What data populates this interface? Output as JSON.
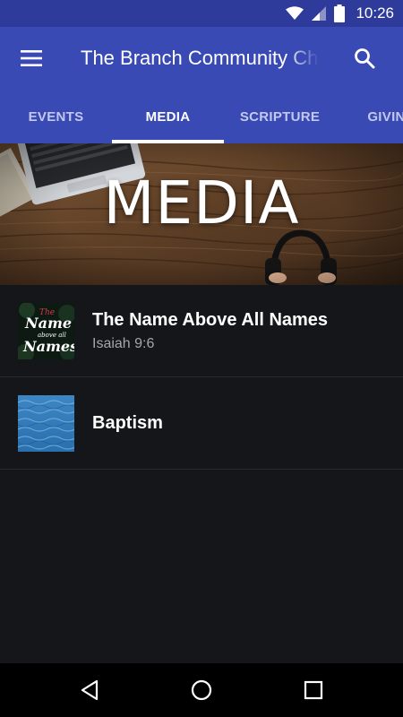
{
  "status_bar": {
    "time": "10:26",
    "icons": [
      "wifi-icon",
      "signal-icon",
      "battery-icon"
    ]
  },
  "app_bar": {
    "title": "The Branch Community Church",
    "menu_icon": "hamburger-menu-icon",
    "search_icon": "search-icon"
  },
  "tabs": [
    {
      "label": "EVENTS",
      "active": false
    },
    {
      "label": "MEDIA",
      "active": true
    },
    {
      "label": "SCRIPTURE",
      "active": false
    },
    {
      "label": "GIVING",
      "active": false
    }
  ],
  "banner": {
    "title": "MEDIA"
  },
  "media_items": [
    {
      "title": "The Name Above All Names",
      "subtitle": "Isaiah 9:6",
      "thumb_text": {
        "line1": "The",
        "line2": "Name",
        "line3": "above all",
        "line4": "Names"
      }
    },
    {
      "title": "Baptism",
      "subtitle": ""
    }
  ],
  "nav_bar": {
    "icons": [
      "back-icon",
      "home-icon",
      "recents-icon"
    ]
  },
  "colors": {
    "status_bar": "#2e3b9b",
    "app_bar": "#3a4ab4",
    "background": "#151619",
    "inactive_tab": "#c3c8ee",
    "subtitle": "#a4a6ab"
  }
}
